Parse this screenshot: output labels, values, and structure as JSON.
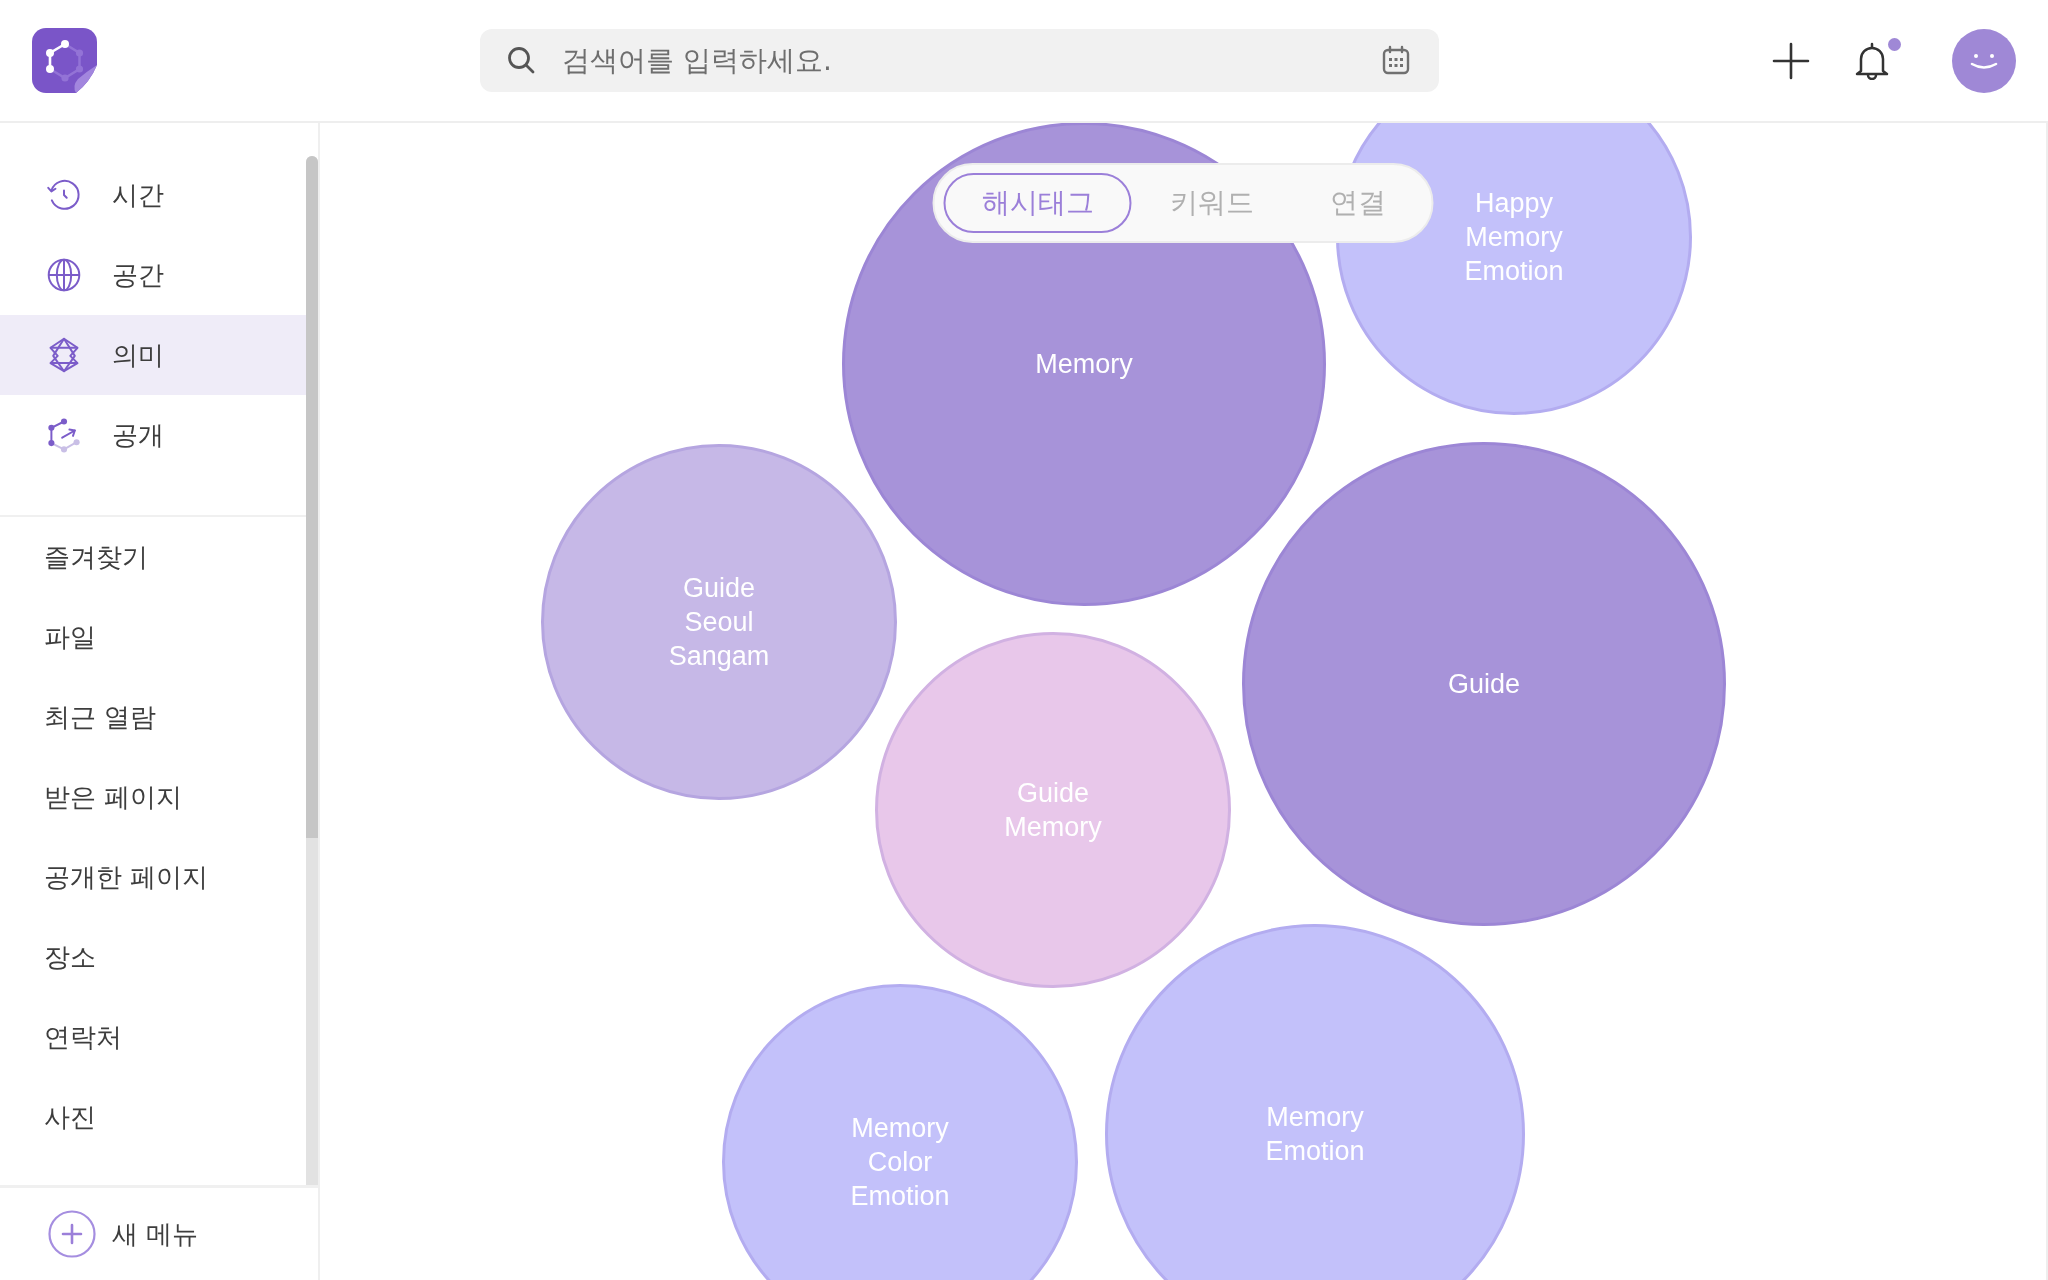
{
  "header": {
    "search": {
      "placeholder": "검색어를 입력하세요."
    },
    "notifications": {
      "unread": true
    }
  },
  "sidebar": {
    "views": [
      {
        "label": "시간",
        "selected": false
      },
      {
        "label": "공간",
        "selected": false
      },
      {
        "label": "의미",
        "selected": true
      },
      {
        "label": "공개",
        "selected": false
      }
    ],
    "menu": [
      "즐겨찾기",
      "파일",
      "최근 열람",
      "받은 페이지",
      "공개한 페이지",
      "장소",
      "연락처",
      "사진"
    ],
    "new_menu_button": "새 메뉴"
  },
  "view_tabs": [
    {
      "label": "해시태그",
      "selected": true
    },
    {
      "label": "키워드",
      "selected": false
    },
    {
      "label": "연결",
      "selected": false
    }
  ],
  "bubbles": [
    {
      "tags": [
        "Memory"
      ],
      "kind": "large",
      "color": "#a793d9"
    },
    {
      "tags": [
        "Happy",
        "Memory",
        "Emotion"
      ],
      "kind": "small",
      "color": "#c3c1fa"
    },
    {
      "tags": [
        "Guide",
        "Seoul",
        "Sangam"
      ],
      "kind": "small",
      "color": "#c6b8e7"
    },
    {
      "tags": [
        "Guide"
      ],
      "kind": "large",
      "color": "#a793d9"
    },
    {
      "tags": [
        "Guide",
        "Memory"
      ],
      "kind": "small",
      "color": "#e8c7ea"
    },
    {
      "tags": [
        "Memory",
        "Color",
        "Emotion"
      ],
      "kind": "small",
      "color": "#c3c1fa"
    },
    {
      "tags": [
        "Memory",
        "Emotion"
      ],
      "kind": "medium",
      "color": "#c3c1fa"
    }
  ]
}
